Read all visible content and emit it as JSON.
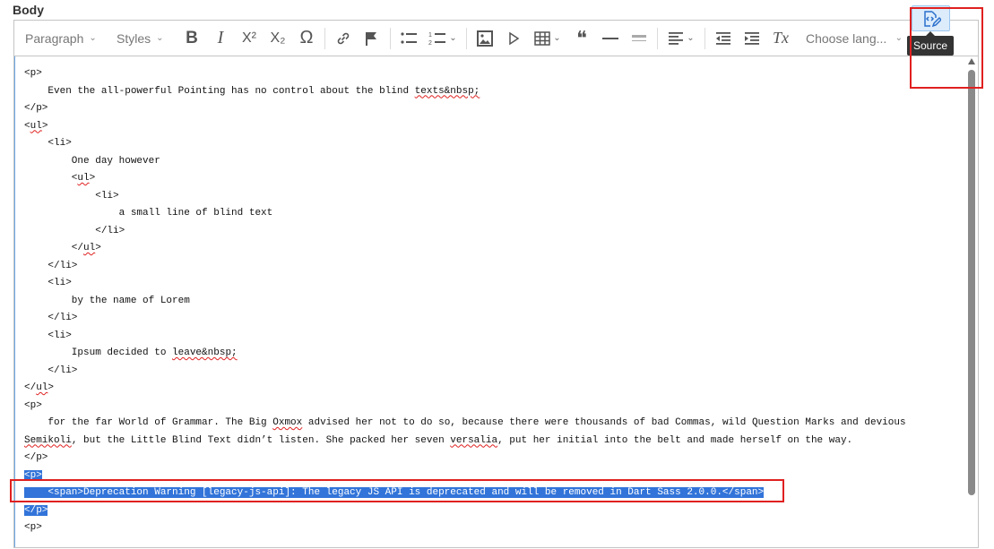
{
  "field_label": "Body",
  "toolbar": {
    "heading_dropdown": "Paragraph",
    "styles_dropdown": "Styles",
    "language_dropdown": "Choose lang...",
    "bold_label": "B",
    "italic_label": "I",
    "superscript_label": "X²",
    "subscript_label": "X₂",
    "special_char_label": "Ω",
    "blockquote_label": "❝",
    "remove_format_label": "Tx",
    "icons": [
      "bold-icon",
      "italic-icon",
      "superscript-icon",
      "subscript-icon",
      "special-characters-icon",
      "link-icon",
      "flag-icon",
      "bulleted-list-icon",
      "numbered-list-icon",
      "image-icon",
      "media-icon",
      "table-icon",
      "blockquote-icon",
      "horizontal-line-icon",
      "code-block-icon",
      "alignment-icon",
      "outdent-icon",
      "indent-icon",
      "remove-format-icon",
      "source-icon"
    ],
    "source_tooltip": "Source"
  },
  "source": {
    "lines": [
      "<p>",
      "    Even the all-powerful Pointing has no control about the blind texts&nbsp;",
      "</p>",
      "<ul>",
      "    <li>",
      "        One day however",
      "        <ul>",
      "            <li>",
      "                a small line of blind text",
      "            </li>",
      "        </ul>",
      "    </li>",
      "    <li>",
      "        by the name of Lorem",
      "    </li>",
      "    <li>",
      "        Ipsum decided to leave&nbsp;",
      "    </li>",
      "</ul>",
      "<p>",
      "    for the far World of Grammar. The Big Oxmox advised her not to do so, because there were thousands of bad Commas, wild Question Marks and devious Semikoli, but the Little Blind Text didn’t listen. She packed her seven versalia, put her initial into the belt and made herself on the way.",
      "</p>",
      "<p>",
      "    <span>Deprecation Warning [legacy-js-api]: The legacy JS API is deprecated and will be removed in Dart Sass 2.0.0.</span>",
      "</p>",
      "<p>"
    ]
  },
  "colors": {
    "selection": "#3274d9",
    "highlight_box": "#e02020",
    "source_active_bg": "#dcecfb"
  }
}
